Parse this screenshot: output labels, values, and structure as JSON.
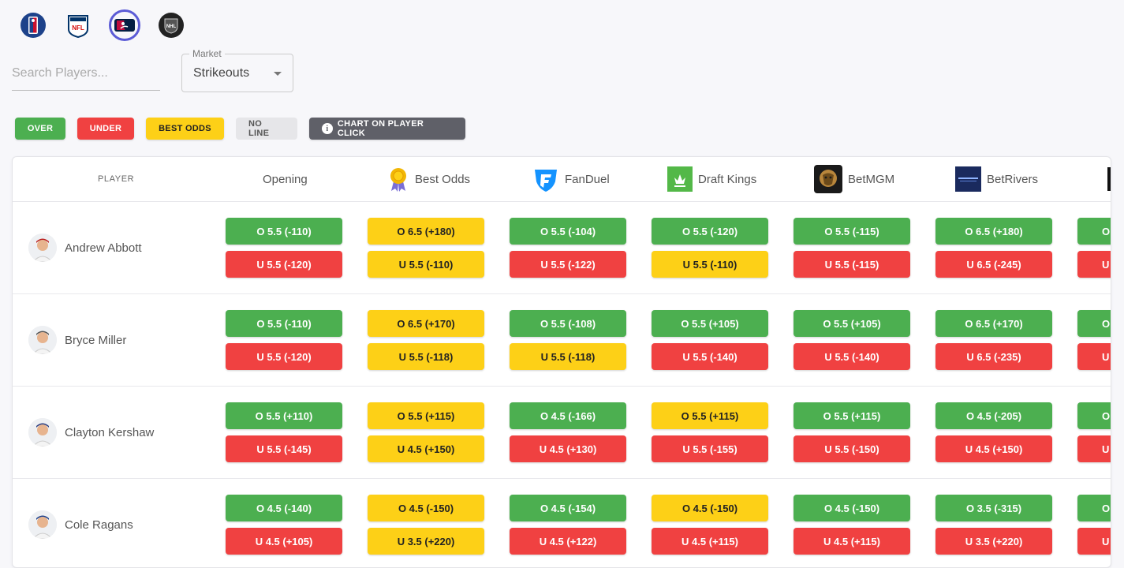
{
  "leagues": [
    {
      "name": "NBA",
      "icon": "nba-logo-icon"
    },
    {
      "name": "NFL",
      "icon": "nfl-logo-icon"
    },
    {
      "name": "MLB",
      "icon": "mlb-logo-icon",
      "active": true
    },
    {
      "name": "NHL",
      "icon": "nhl-logo-icon"
    }
  ],
  "search": {
    "placeholder": "Search Players..."
  },
  "market": {
    "label": "Market",
    "value": "Strikeouts"
  },
  "legend": {
    "over": "OVER",
    "under": "UNDER",
    "best_odds": "BEST ODDS",
    "no_line": "NO LINE",
    "chart": "CHART ON PLAYER CLICK"
  },
  "colors": {
    "over": "#4caf50",
    "under": "#f04141",
    "best": "#fdd017",
    "no_line": "#e6e6e9",
    "chart": "#5f6068",
    "accent": "#5b5bd6"
  },
  "table": {
    "columns": {
      "player": "PLAYER",
      "opening": "Opening",
      "best_odds": "Best Odds",
      "fanduel": "FanDuel",
      "draftkings": "Draft Kings",
      "betmgm": "BetMGM",
      "betrivers": "BetRivers"
    },
    "rows": [
      {
        "player": "Andrew Abbott",
        "opening": {
          "over": "O 5.5 (-110)",
          "under": "U 5.5 (-120)"
        },
        "best": {
          "over": "O 6.5 (+180)",
          "under": "U 5.5 (-110)"
        },
        "fanduel": {
          "over": "O 5.5 (-104)",
          "under": "U 5.5 (-122)"
        },
        "draftkings": {
          "over": "O 5.5 (-120)",
          "under": "U 5.5 (-110)"
        },
        "betmgm": {
          "over": "O 5.5 (-115)",
          "under": "U 5.5 (-115)"
        },
        "betrivers": {
          "over": "O 6.5 (+180)",
          "under": "U 6.5 (-245)"
        },
        "next": {
          "over": "O",
          "under": "U"
        }
      },
      {
        "player": "Bryce Miller",
        "opening": {
          "over": "O 5.5 (-110)",
          "under": "U 5.5 (-120)"
        },
        "best": {
          "over": "O 6.5 (+170)",
          "under": "U 5.5 (-118)"
        },
        "fanduel": {
          "over": "O 5.5 (-108)",
          "under": "U 5.5 (-118)"
        },
        "draftkings": {
          "over": "O 5.5 (+105)",
          "under": "U 5.5 (-140)"
        },
        "betmgm": {
          "over": "O 5.5 (+105)",
          "under": "U 5.5 (-140)"
        },
        "betrivers": {
          "over": "O 6.5 (+170)",
          "under": "U 6.5 (-235)"
        },
        "next": {
          "over": "O",
          "under": "U"
        }
      },
      {
        "player": "Clayton Kershaw",
        "opening": {
          "over": "O 5.5 (+110)",
          "under": "U 5.5 (-145)"
        },
        "best": {
          "over": "O 5.5 (+115)",
          "under": "U 4.5 (+150)"
        },
        "fanduel": {
          "over": "O 4.5 (-166)",
          "under": "U 4.5 (+130)"
        },
        "draftkings": {
          "over": "O 5.5 (+115)",
          "under": "U 5.5 (-155)"
        },
        "betmgm": {
          "over": "O 5.5 (+115)",
          "under": "U 5.5 (-150)"
        },
        "betrivers": {
          "over": "O 4.5 (-205)",
          "under": "U 4.5 (+150)"
        },
        "next": {
          "over": "O",
          "under": "U"
        }
      },
      {
        "player": "Cole Ragans",
        "opening": {
          "over": "O 4.5 (-140)",
          "under": "U 4.5 (+105)"
        },
        "best": {
          "over": "O 4.5 (-150)",
          "under": "U 3.5 (+220)"
        },
        "fanduel": {
          "over": "O 4.5 (-154)",
          "under": "U 4.5 (+122)"
        },
        "draftkings": {
          "over": "O 4.5 (-150)",
          "under": "U 4.5 (+115)"
        },
        "betmgm": {
          "over": "O 4.5 (-150)",
          "under": "U 4.5 (+115)"
        },
        "betrivers": {
          "over": "O 3.5 (-315)",
          "under": "U 3.5 (+220)"
        },
        "next": {
          "over": "O",
          "under": "U"
        }
      }
    ]
  }
}
